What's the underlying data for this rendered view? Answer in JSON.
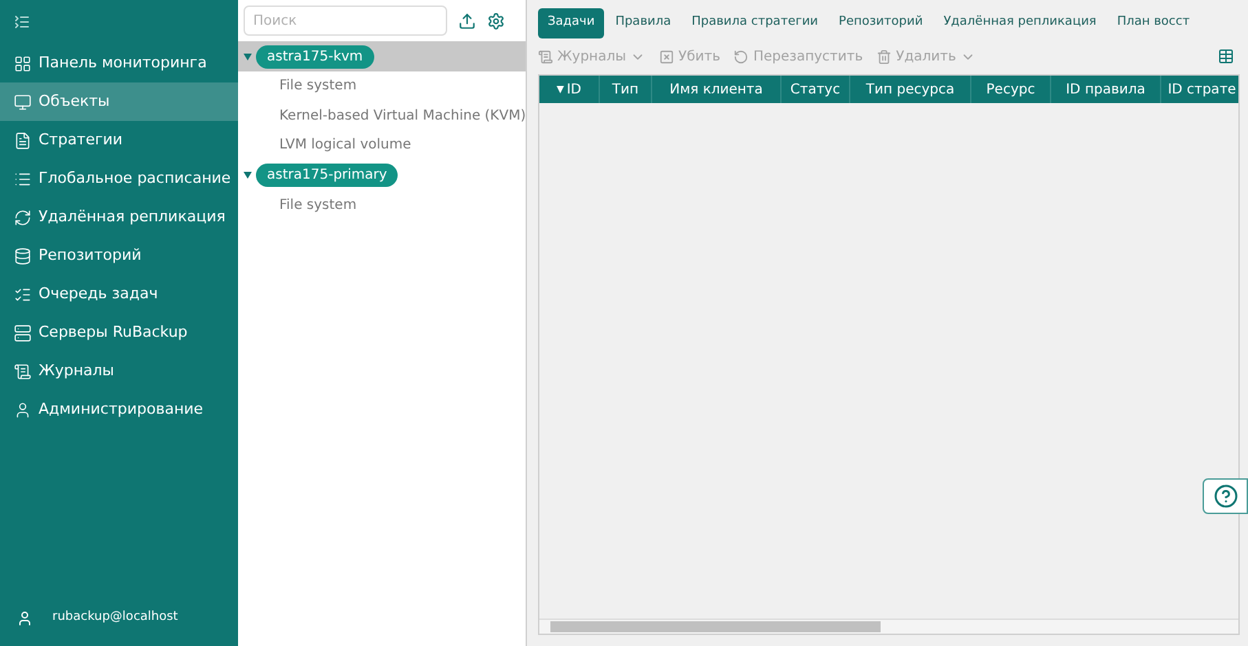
{
  "sidebar": {
    "items": [
      {
        "label": "Панель мониторинга",
        "selected": false
      },
      {
        "label": "Объекты",
        "selected": true
      },
      {
        "label": "Стратегии",
        "selected": false
      },
      {
        "label": "Глобальное расписание",
        "selected": false
      },
      {
        "label": "Удалённая репликация",
        "selected": false
      },
      {
        "label": "Репозиторий",
        "selected": false
      },
      {
        "label": "Очередь задач",
        "selected": false
      },
      {
        "label": "Серверы RuBackup",
        "selected": false
      },
      {
        "label": "Журналы",
        "selected": false
      },
      {
        "label": "Администрирование",
        "selected": false
      }
    ],
    "user": "rubackup@localhost"
  },
  "tree": {
    "search": {
      "placeholder": "Поиск"
    },
    "hosts": [
      {
        "label": "astra175-kvm",
        "expanded": true,
        "selected": true,
        "children": [
          {
            "label": "File system"
          },
          {
            "label": "Kernel-based Virtual Machine (KVM)"
          },
          {
            "label": "LVM logical volume"
          }
        ]
      },
      {
        "label": "astra175-primary",
        "expanded": true,
        "selected": false,
        "children": [
          {
            "label": "File system"
          }
        ]
      }
    ]
  },
  "tabs": [
    {
      "label": "Задачи",
      "selected": true
    },
    {
      "label": "Правила",
      "selected": false
    },
    {
      "label": "Правила стратегии",
      "selected": false
    },
    {
      "label": "Репозиторий",
      "selected": false
    },
    {
      "label": "Удалённая репликация",
      "selected": false
    },
    {
      "label": "План восст",
      "selected": false
    }
  ],
  "toolbar": [
    {
      "label": "Журналы",
      "dropdown": true,
      "disabled": true
    },
    {
      "label": "Убить",
      "dropdown": false,
      "disabled": true
    },
    {
      "label": "Перезапустить",
      "dropdown": false,
      "disabled": true
    },
    {
      "label": "Удалить",
      "dropdown": true,
      "disabled": true
    }
  ],
  "table": {
    "columns": [
      {
        "label": "ID",
        "sorted": true,
        "sort_mark": "▼"
      },
      {
        "label": "Тип",
        "sorted": false
      },
      {
        "label": "Имя клиента",
        "sorted": false
      },
      {
        "label": "Статус",
        "sorted": false
      },
      {
        "label": "Тип ресурса",
        "sorted": false
      },
      {
        "label": "Ресурс",
        "sorted": false
      },
      {
        "label": "ID правила",
        "sorted": false
      },
      {
        "label": "ID страте",
        "sorted": false
      }
    ]
  }
}
